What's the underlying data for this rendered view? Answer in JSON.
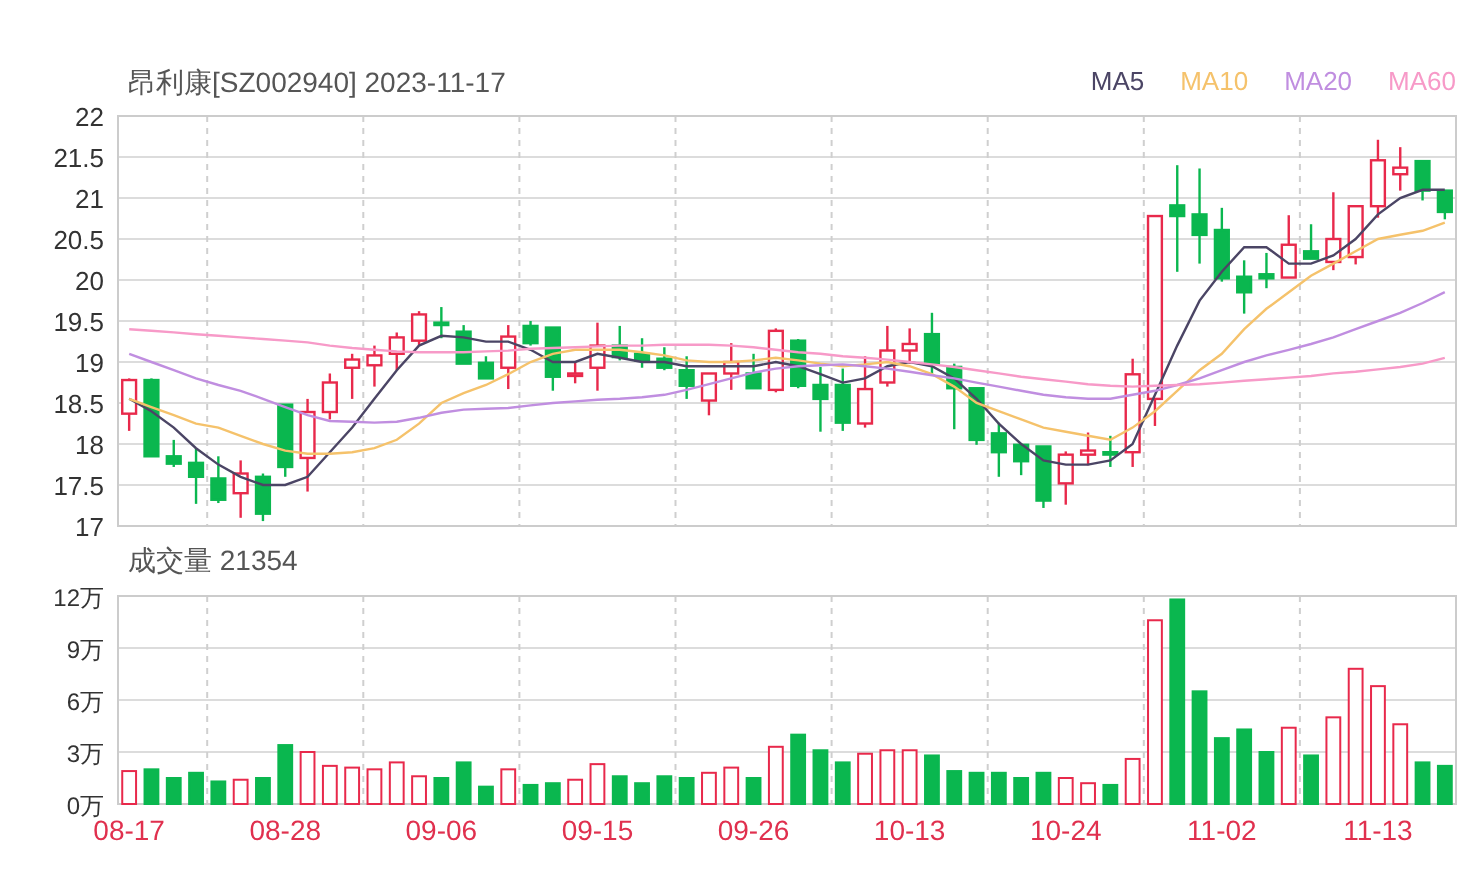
{
  "header": {
    "title": "昂利康[SZ002940] 2023-11-17"
  },
  "price_chart": {
    "chart_data": {
      "type": "candlestick",
      "grid": true,
      "ylim": [
        17,
        22
      ],
      "yticks": [
        {
          "value": 22,
          "label": "22"
        },
        {
          "value": 21.5,
          "label": "21.5"
        },
        {
          "value": 21,
          "label": "21"
        },
        {
          "value": 20.5,
          "label": "20.5"
        },
        {
          "value": 20,
          "label": "20"
        },
        {
          "value": 19.5,
          "label": "19.5"
        },
        {
          "value": 19,
          "label": "19"
        },
        {
          "value": 18.5,
          "label": "18.5"
        },
        {
          "value": 18,
          "label": "18"
        },
        {
          "value": 17.5,
          "label": "17.5"
        },
        {
          "value": 17,
          "label": "17"
        }
      ],
      "series": [
        {
          "name": "MA5",
          "type": "line",
          "color": "#4b4565",
          "values": [
            18.55,
            18.4,
            18.2,
            17.95,
            17.75,
            17.6,
            17.5,
            17.5,
            17.6,
            17.9,
            18.2,
            18.55,
            18.9,
            19.2,
            19.32,
            19.3,
            19.25,
            19.25,
            19.15,
            19.0,
            19.0,
            19.1,
            19.05,
            19.0,
            19.0,
            18.95,
            18.95,
            18.95,
            18.95,
            19.0,
            18.95,
            18.85,
            18.75,
            18.8,
            18.95,
            19.0,
            18.95,
            18.8,
            18.55,
            18.25,
            18.0,
            17.8,
            17.75,
            17.75,
            17.8,
            18.0,
            18.6,
            19.2,
            19.75,
            20.1,
            20.4,
            20.4,
            20.2,
            20.2,
            20.3,
            20.5,
            20.8,
            21.0,
            21.1,
            21.1
          ]
        },
        {
          "name": "MA10",
          "type": "line",
          "color": "#f5c26b",
          "values": [
            18.55,
            18.45,
            18.35,
            18.25,
            18.2,
            18.1,
            18.0,
            17.92,
            17.88,
            17.88,
            17.9,
            17.95,
            18.05,
            18.25,
            18.5,
            18.62,
            18.72,
            18.85,
            19.0,
            19.1,
            19.15,
            19.15,
            19.15,
            19.12,
            19.08,
            19.02,
            19.0,
            19.0,
            19.02,
            19.05,
            19.02,
            18.98,
            18.95,
            18.97,
            19.0,
            18.95,
            18.85,
            18.7,
            18.5,
            18.4,
            18.3,
            18.2,
            18.15,
            18.1,
            18.05,
            18.2,
            18.4,
            18.65,
            18.9,
            19.1,
            19.4,
            19.65,
            19.85,
            20.05,
            20.2,
            20.35,
            20.5,
            20.55,
            20.6,
            20.7
          ]
        },
        {
          "name": "MA20",
          "type": "line",
          "color": "#c08ee0",
          "values": [
            19.1,
            19.0,
            18.9,
            18.8,
            18.72,
            18.65,
            18.55,
            18.45,
            18.35,
            18.28,
            18.27,
            18.26,
            18.27,
            18.32,
            18.38,
            18.42,
            18.43,
            18.44,
            18.47,
            18.5,
            18.52,
            18.54,
            18.55,
            18.57,
            18.6,
            18.66,
            18.73,
            18.8,
            18.87,
            18.92,
            18.95,
            18.96,
            18.97,
            18.95,
            18.92,
            18.88,
            18.84,
            18.8,
            18.75,
            18.7,
            18.65,
            18.6,
            18.57,
            18.55,
            18.55,
            18.6,
            18.65,
            18.72,
            18.8,
            18.9,
            19.0,
            19.08,
            19.15,
            19.22,
            19.3,
            19.4,
            19.5,
            19.6,
            19.72,
            19.85
          ]
        },
        {
          "name": "MA60",
          "type": "line",
          "color": "#f79ac8",
          "values": [
            19.4,
            19.38,
            19.36,
            19.34,
            19.32,
            19.3,
            19.28,
            19.26,
            19.24,
            19.2,
            19.17,
            19.15,
            19.13,
            19.12,
            19.12,
            19.12,
            19.13,
            19.14,
            19.16,
            19.17,
            19.18,
            19.19,
            19.2,
            19.2,
            19.21,
            19.21,
            19.21,
            19.2,
            19.18,
            19.15,
            19.12,
            19.1,
            19.07,
            19.05,
            19.03,
            19.0,
            18.97,
            18.94,
            18.9,
            18.86,
            18.82,
            18.79,
            18.76,
            18.73,
            18.71,
            18.7,
            18.71,
            18.72,
            18.73,
            18.75,
            18.77,
            18.79,
            18.81,
            18.83,
            18.86,
            18.88,
            18.91,
            18.94,
            18.98,
            19.05
          ]
        }
      ],
      "ohlc": [
        [
          18.37,
          18.8,
          18.16,
          18.78
        ],
        [
          18.78,
          18.8,
          17.85,
          17.85
        ],
        [
          17.85,
          18.05,
          17.72,
          17.76
        ],
        [
          17.77,
          17.95,
          17.27,
          17.6
        ],
        [
          17.58,
          17.85,
          17.28,
          17.32
        ],
        [
          17.4,
          17.8,
          17.1,
          17.64
        ],
        [
          17.6,
          17.64,
          17.06,
          17.15
        ],
        [
          18.48,
          18.48,
          17.6,
          17.72
        ],
        [
          17.83,
          18.55,
          17.42,
          18.39
        ],
        [
          18.39,
          18.86,
          18.3,
          18.75
        ],
        [
          18.93,
          19.1,
          18.55,
          19.03
        ],
        [
          18.96,
          19.2,
          18.7,
          19.08
        ],
        [
          19.1,
          19.36,
          18.9,
          19.3
        ],
        [
          19.26,
          19.62,
          19.2,
          19.58
        ],
        [
          19.48,
          19.67,
          19.29,
          19.46
        ],
        [
          19.37,
          19.45,
          18.98,
          18.98
        ],
        [
          18.99,
          19.07,
          18.8,
          18.8
        ],
        [
          18.93,
          19.45,
          18.67,
          19.31
        ],
        [
          19.44,
          19.5,
          19.2,
          19.23
        ],
        [
          19.42,
          19.42,
          18.65,
          18.82
        ],
        [
          18.83,
          19.0,
          18.74,
          18.86
        ],
        [
          18.93,
          19.48,
          18.65,
          19.2
        ],
        [
          19.2,
          19.44,
          19.02,
          19.06
        ],
        [
          19.1,
          19.29,
          18.93,
          19.02
        ],
        [
          19.04,
          19.18,
          18.9,
          18.93
        ],
        [
          18.9,
          19.07,
          18.55,
          18.71
        ],
        [
          18.53,
          18.86,
          18.35,
          18.86
        ],
        [
          18.86,
          19.23,
          18.66,
          19.0
        ],
        [
          18.86,
          19.1,
          18.68,
          18.68
        ],
        [
          18.66,
          19.41,
          18.63,
          19.38
        ],
        [
          19.26,
          19.28,
          18.68,
          18.71
        ],
        [
          18.72,
          18.94,
          18.15,
          18.55
        ],
        [
          18.72,
          18.92,
          18.16,
          18.26
        ],
        [
          18.25,
          19.07,
          18.2,
          18.67
        ],
        [
          18.75,
          19.44,
          18.7,
          19.14
        ],
        [
          19.14,
          19.41,
          18.98,
          19.22
        ],
        [
          19.34,
          19.6,
          18.86,
          18.98
        ],
        [
          18.94,
          18.98,
          18.18,
          18.68
        ],
        [
          18.68,
          18.68,
          17.99,
          18.05
        ],
        [
          18.13,
          18.26,
          17.6,
          17.9
        ],
        [
          17.99,
          17.99,
          17.62,
          17.79
        ],
        [
          17.97,
          17.97,
          17.22,
          17.31
        ],
        [
          17.52,
          17.91,
          17.26,
          17.87
        ],
        [
          17.87,
          18.14,
          17.74,
          17.92
        ],
        [
          17.9,
          18.1,
          17.72,
          17.88
        ],
        [
          17.9,
          19.04,
          17.72,
          18.85
        ],
        [
          18.55,
          20.78,
          18.22,
          20.78
        ],
        [
          20.91,
          21.4,
          20.1,
          20.78
        ],
        [
          20.8,
          21.36,
          20.2,
          20.55
        ],
        [
          20.61,
          20.88,
          19.98,
          20.02
        ],
        [
          20.04,
          20.24,
          19.59,
          19.85
        ],
        [
          20.07,
          20.33,
          19.9,
          20.02
        ],
        [
          20.03,
          20.79,
          20.03,
          20.43
        ],
        [
          20.35,
          20.68,
          20.26,
          20.26
        ],
        [
          20.22,
          21.07,
          20.12,
          20.5
        ],
        [
          20.28,
          20.91,
          20.19,
          20.9
        ],
        [
          20.9,
          21.71,
          20.76,
          21.46
        ],
        [
          21.29,
          21.62,
          21.09,
          21.37
        ],
        [
          21.45,
          21.45,
          20.97,
          21.09
        ],
        [
          21.09,
          21.09,
          20.74,
          20.83
        ]
      ]
    }
  },
  "volume_chart": {
    "title": "成交量 21354",
    "chart_data": {
      "type": "bar",
      "grid": true,
      "ylim": [
        0,
        12
      ],
      "yticks": [
        {
          "value": 12,
          "label": "12万"
        },
        {
          "value": 9,
          "label": "9万"
        },
        {
          "value": 6,
          "label": "6万"
        },
        {
          "value": 3,
          "label": "3万"
        },
        {
          "value": 0,
          "label": "0万"
        }
      ],
      "categories": [
        "08-17",
        null,
        null,
        null,
        null,
        null,
        null,
        "08-28",
        null,
        null,
        null,
        null,
        null,
        null,
        "09-06",
        null,
        null,
        null,
        null,
        null,
        null,
        "09-15",
        null,
        null,
        null,
        null,
        null,
        null,
        "09-26",
        null,
        null,
        null,
        null,
        null,
        null,
        "10-13",
        null,
        null,
        null,
        null,
        null,
        null,
        "10-24",
        null,
        null,
        null,
        null,
        null,
        null,
        "11-02",
        null,
        null,
        null,
        null,
        null,
        null,
        "11-13",
        null,
        null,
        null
      ],
      "values": [
        1.9,
        2.0,
        1.5,
        1.8,
        1.3,
        1.4,
        1.5,
        3.4,
        3.0,
        2.2,
        2.1,
        2.0,
        2.4,
        1.6,
        1.5,
        2.4,
        1.0,
        2.0,
        1.1,
        1.2,
        1.4,
        2.3,
        1.6,
        1.2,
        1.6,
        1.5,
        1.8,
        2.1,
        1.5,
        3.3,
        4.0,
        3.1,
        2.4,
        2.9,
        3.1,
        3.1,
        2.8,
        1.9,
        1.8,
        1.8,
        1.5,
        1.8,
        1.5,
        1.2,
        1.1,
        2.6,
        10.6,
        11.8,
        6.5,
        3.8,
        4.3,
        3.0,
        4.4,
        2.8,
        5.0,
        7.8,
        6.8,
        4.6,
        2.4,
        2.2
      ]
    }
  }
}
